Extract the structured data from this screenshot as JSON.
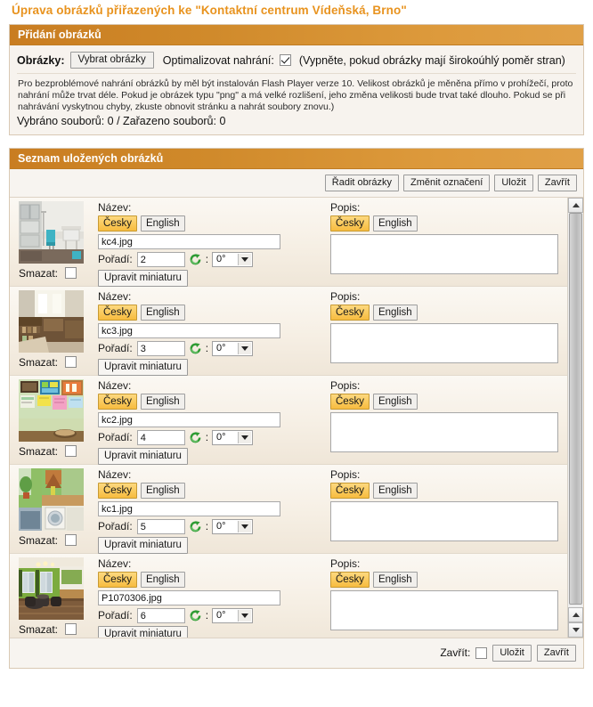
{
  "page_title": "Úprava obrázků přiřazených ke \"Kontaktní centrum Vídeňská, Brno\"",
  "colors": {
    "title": "#e8931f",
    "header_gradient_start": "#c97d21",
    "header_gradient_end": "#e0a047",
    "active_tab": "#f7bc3f",
    "panel_bg": "#f7f3ee"
  },
  "upload_panel": {
    "header": "Přidání obrázků",
    "images_label": "Obrázky:",
    "select_button": "Vybrat obrázky",
    "optimize_label": "Optimalizovat nahrání:",
    "optimize_checked": true,
    "optimize_hint": "(Vypněte, pokud obrázky mají širokoúhlý poměr stran)",
    "note": "Pro bezproblémové nahrání obrázků by měl být instalován Flash Player verze 10. Velikost obrázků je měněna přímo v prohížečí, proto nahrání může trvat déle. Pokud je obrázek typu \"png\" a má velké rozlišení, jeho změna velikosti bude trvat také dlouho. Pokud se při nahrávání vyskytnou chyby, zkuste obnovit stránku a nahrát soubory znovu.)",
    "counts": "Vybráno souborů: 0 / Zařazeno souborů: 0"
  },
  "list_panel": {
    "header": "Seznam uložených obrázků",
    "toolbar": [
      {
        "label": "Řadit obrázky",
        "name": "sort-images-button"
      },
      {
        "label": "Změnit označení",
        "name": "change-label-button"
      },
      {
        "label": "Uložit",
        "name": "save-button"
      },
      {
        "label": "Zavřít",
        "name": "close-button"
      }
    ],
    "row_labels": {
      "name": "Název:",
      "description": "Popis:",
      "order": "Pořadí:",
      "delete": "Smazat:",
      "edit_thumb": "Upravit miniaturu",
      "colon": ":",
      "lang_cs": "Česky",
      "lang_en": "English"
    },
    "rows": [
      {
        "filename": "kc4.jpg",
        "order": "2",
        "rotation": "0°",
        "description": "",
        "delete_checked": false,
        "name_lang_active": "Česky",
        "desc_lang_active": "Česky",
        "thumb_alt": "clinic-room-thumbnail"
      },
      {
        "filename": "kc3.jpg",
        "order": "3",
        "rotation": "0°",
        "description": "",
        "delete_checked": false,
        "name_lang_active": "Česky",
        "desc_lang_active": "Česky",
        "thumb_alt": "office-shelves-thumbnail"
      },
      {
        "filename": "kc2.jpg",
        "order": "4",
        "rotation": "0°",
        "description": "",
        "delete_checked": false,
        "name_lang_active": "Česky",
        "desc_lang_active": "Česky",
        "thumb_alt": "bulletin-board-thumbnail"
      },
      {
        "filename": "kc1.jpg",
        "order": "5",
        "rotation": "0°",
        "description": "",
        "delete_checked": false,
        "name_lang_active": "Česky",
        "desc_lang_active": "Česky",
        "thumb_alt": "kitchen-corner-thumbnail"
      },
      {
        "filename": "P1070306.jpg",
        "order": "6",
        "rotation": "0°",
        "description": "",
        "delete_checked": false,
        "name_lang_active": "Česky",
        "desc_lang_active": "Česky",
        "thumb_alt": "green-lounge-thumbnail"
      }
    ],
    "footer": {
      "close_label": "Zavřít:",
      "close_checked": false,
      "save_button": "Uložit",
      "close_button": "Zavřít"
    }
  }
}
